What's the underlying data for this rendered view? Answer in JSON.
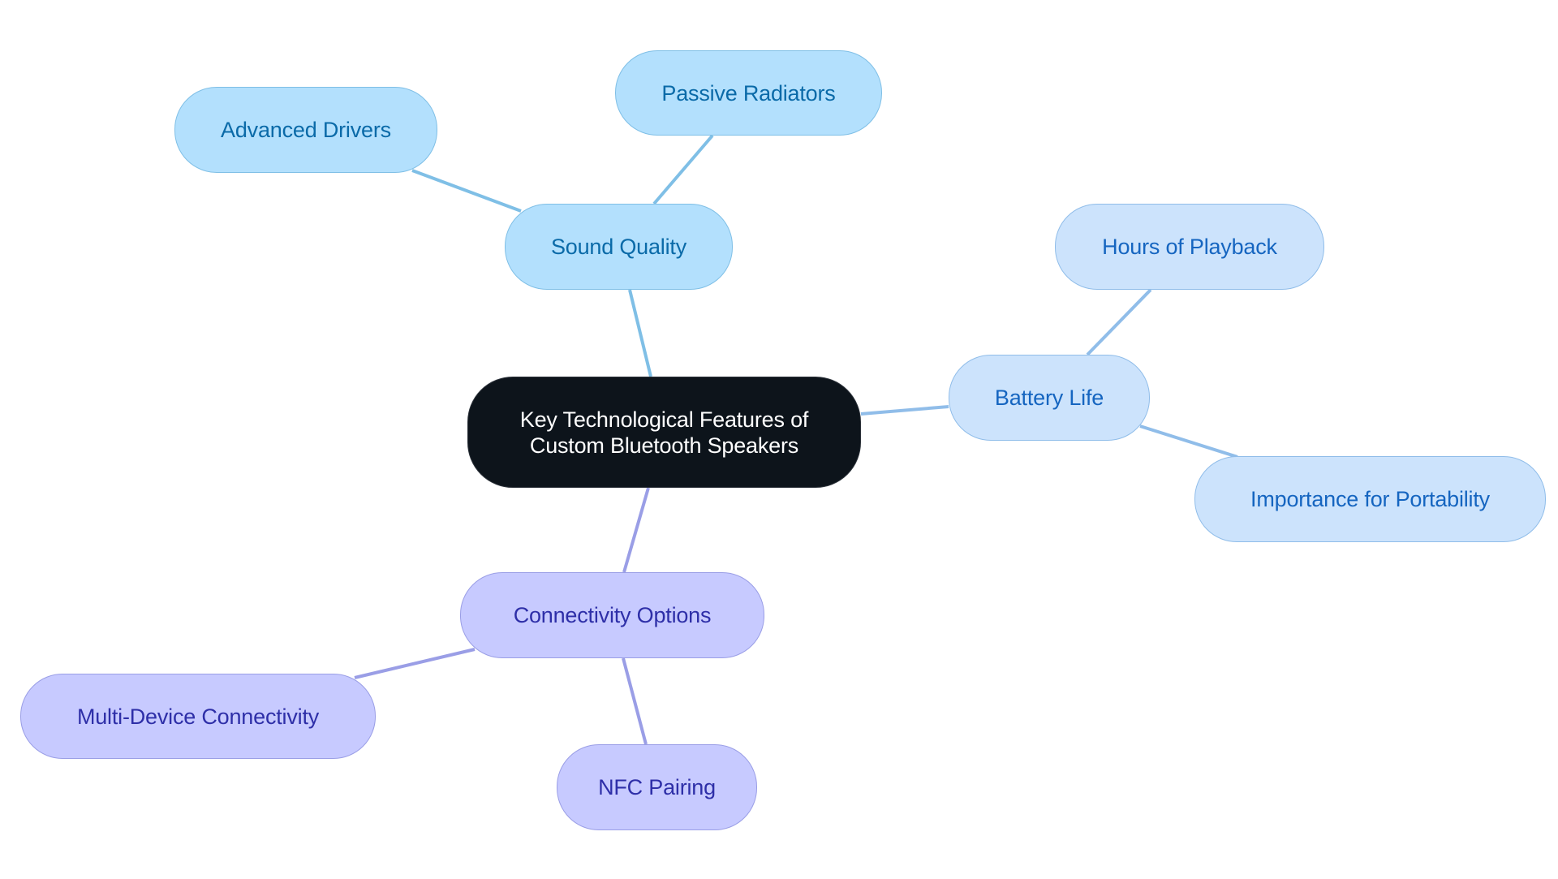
{
  "diagram": {
    "type": "mind-map",
    "root": {
      "id": "root",
      "label": "Key Technological Features of\nCustom Bluetooth Speakers"
    },
    "branches": [
      {
        "id": "sound",
        "label": "Sound Quality",
        "color": {
          "fill": "#b3e0fd",
          "stroke": "#7fbfe6",
          "text": "#0a6aa8"
        },
        "children": [
          {
            "id": "drivers",
            "label": "Advanced Drivers"
          },
          {
            "id": "radiators",
            "label": "Passive Radiators"
          }
        ]
      },
      {
        "id": "battery",
        "label": "Battery Life",
        "color": {
          "fill": "#cce3fc",
          "stroke": "#90bde9",
          "text": "#1565c0"
        },
        "children": [
          {
            "id": "playback",
            "label": "Hours of Playback"
          },
          {
            "id": "portability",
            "label": "Importance for Portability"
          }
        ]
      },
      {
        "id": "conn",
        "label": "Connectivity Options",
        "color": {
          "fill": "#c7caff",
          "stroke": "#9a9ee6",
          "text": "#2e2fa8"
        },
        "children": [
          {
            "id": "multidevice",
            "label": "Multi-Device Connectivity"
          },
          {
            "id": "nfc",
            "label": "NFC Pairing"
          }
        ]
      }
    ]
  },
  "labels": {
    "root": "Key Technological Features of\nCustom Bluetooth Speakers",
    "sound": "Sound Quality",
    "drivers": "Advanced Drivers",
    "radiators": "Passive Radiators",
    "battery": "Battery Life",
    "playback": "Hours of Playback",
    "portability": "Importance for Portability",
    "conn": "Connectivity Options",
    "multidevice": "Multi-Device Connectivity",
    "nfc": "NFC Pairing"
  }
}
